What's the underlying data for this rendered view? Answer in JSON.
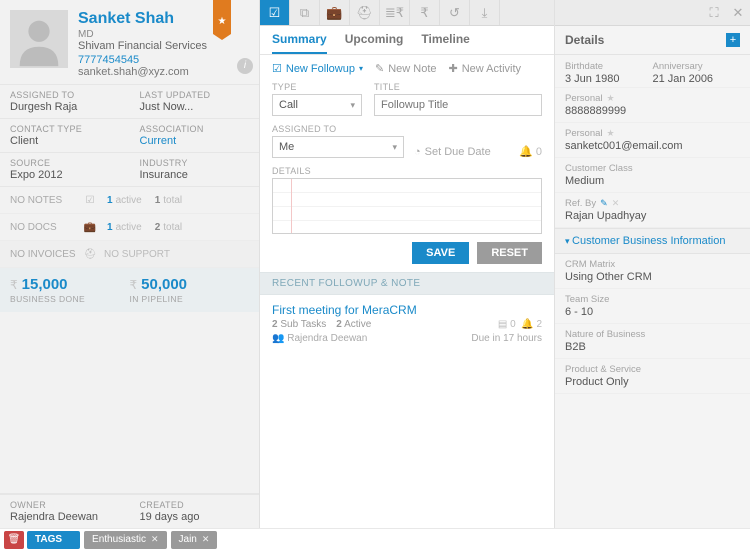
{
  "profile": {
    "name": "Sanket Shah",
    "role": "MD",
    "company": "Shivam Financial Services",
    "phone": "7777454545",
    "email": "sanket.shah@xyz.com"
  },
  "meta": {
    "assigned_to_lbl": "ASSIGNED TO",
    "assigned_to": "Durgesh Raja",
    "last_updated_lbl": "LAST UPDATED",
    "last_updated": "Just Now...",
    "contact_type_lbl": "CONTACT TYPE",
    "contact_type": "Client",
    "association_lbl": "ASSOCIATION",
    "association": "Current",
    "source_lbl": "SOURCE",
    "source": "Expo 2012",
    "industry_lbl": "INDUSTRY",
    "industry": "Insurance"
  },
  "counters": {
    "no_notes": "NO NOTES",
    "notes_active_n": "1",
    "notes_active": "active",
    "notes_total_n": "1",
    "notes_total": "total",
    "no_docs": "NO DOCS",
    "docs_active_n": "1",
    "docs_active": "active",
    "docs_total_n": "2",
    "docs_total": "total",
    "no_invoices": "NO INVOICES",
    "no_support": "NO SUPPORT"
  },
  "business": {
    "done_amount": "15,000",
    "done_lbl": "BUSINESS DONE",
    "pipe_amount": "50,000",
    "pipe_lbl": "IN PIPELINE"
  },
  "owner": {
    "owner_lbl": "OWNER",
    "owner": "Rajendra Deewan",
    "created_lbl": "CREATED",
    "created": "19 days ago"
  },
  "tags": {
    "label": "TAGS",
    "t1": "Enthusiastic",
    "t2": "Jain"
  },
  "tabs": {
    "summary": "Summary",
    "upcoming": "Upcoming",
    "timeline": "Timeline"
  },
  "actions": {
    "followup": "New Followup",
    "note": "New Note",
    "activity": "New Activity"
  },
  "form": {
    "type_lbl": "TYPE",
    "type_val": "Call",
    "title_lbl": "TITLE",
    "title_ph": "Followup Title",
    "assigned_lbl": "ASSIGNED TO",
    "assigned_val": "Me",
    "due": "Set Due Date",
    "bell_n": "0",
    "details_lbl": "DETAILS",
    "save": "SAVE",
    "reset": "RESET"
  },
  "recent": {
    "header": "RECENT FOLLOWUP & NOTE",
    "title": "First meeting for MeraCRM",
    "subtasks_n": "2",
    "subtasks": "Sub Tasks",
    "active_n": "2",
    "active": "Active",
    "r_docs": "0",
    "r_bell": "2",
    "who": "Rajendra Deewan",
    "due": "Due in 17 hours"
  },
  "details": {
    "header": "Details",
    "birthdate_lbl": "Birthdate",
    "birthdate": "3 Jun 1980",
    "anniversary_lbl": "Anniversary",
    "anniversary": "21 Jan 2006",
    "personal_phone_lbl": "Personal",
    "personal_phone": "8888889999",
    "personal_email_lbl": "Personal",
    "personal_email": "sanketc001@email.com",
    "class_lbl": "Customer Class",
    "class": "Medium",
    "refby_lbl": "Ref. By",
    "refby": "Rajan Upadhyay",
    "section": "Customer Business Information",
    "crm_lbl": "CRM Matrix",
    "crm": "Using Other CRM",
    "team_lbl": "Team Size",
    "team": "6 - 10",
    "nature_lbl": "Nature of Business",
    "nature": "B2B",
    "product_lbl": "Product & Service",
    "product": "Product Only"
  }
}
